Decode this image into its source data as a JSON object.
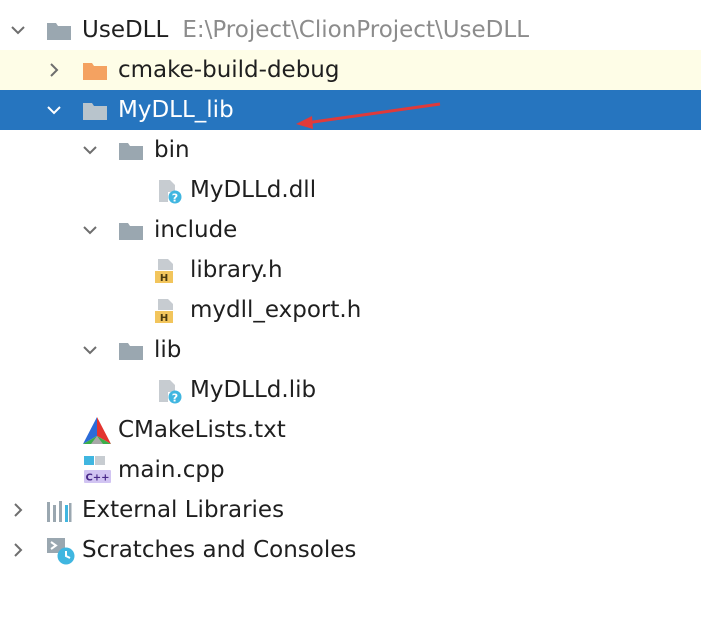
{
  "tree": {
    "root": {
      "label": "UseDLL",
      "path": "E:\\Project\\ClionProject\\UseDLL",
      "icon": "folder-icon",
      "expanded": true
    },
    "cmake_build": {
      "label": "cmake-build-debug",
      "icon": "orange-folder-icon",
      "expanded": false
    },
    "mydll_lib": {
      "label": "MyDLL_lib",
      "icon": "folder-icon",
      "expanded": true,
      "selected": true
    },
    "bin": {
      "label": "bin",
      "icon": "folder-icon",
      "expanded": true
    },
    "bin_file": {
      "label": "MyDLLd.dll",
      "icon": "unknown-file-icon"
    },
    "include": {
      "label": "include",
      "icon": "folder-icon",
      "expanded": true
    },
    "library_h": {
      "label": "library.h",
      "icon": "header-file-icon"
    },
    "mydll_export_h": {
      "label": "mydll_export.h",
      "icon": "header-file-icon"
    },
    "lib": {
      "label": "lib",
      "icon": "folder-icon",
      "expanded": true
    },
    "lib_file": {
      "label": "MyDLLd.lib",
      "icon": "unknown-file-icon"
    },
    "cmakelists": {
      "label": "CMakeLists.txt",
      "icon": "cmake-icon"
    },
    "main_cpp": {
      "label": "main.cpp",
      "icon": "cpp-file-icon"
    },
    "external_libraries": {
      "label": "External Libraries",
      "icon": "libraries-icon",
      "expanded": false
    },
    "scratches": {
      "label": "Scratches and Consoles",
      "icon": "scratches-icon",
      "expanded": false
    }
  },
  "colors": {
    "selection": "#2675bf",
    "highlight": "#fefde7",
    "folder_gray": "#9aa7b0",
    "folder_orange": "#f4a261",
    "arrow": "#e03a3a"
  }
}
